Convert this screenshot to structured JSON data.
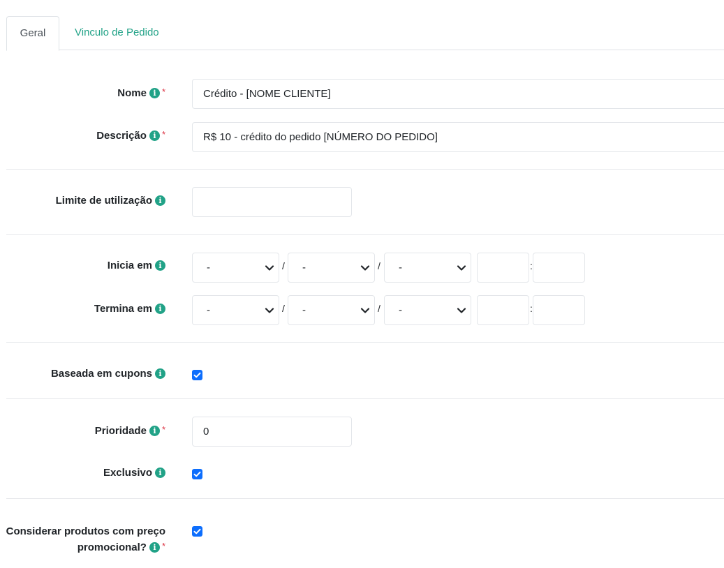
{
  "tabs": [
    {
      "label": "Geral",
      "active": true
    },
    {
      "label": "Vinculo de Pedido",
      "active": false
    }
  ],
  "fields": {
    "nome": {
      "label": "Nome",
      "value": "Crédito - [NOME CLIENTE]",
      "required": "*"
    },
    "descricao": {
      "label": "Descrição",
      "value": "R$ 10 - crédito do pedido [NÚMERO DO PEDIDO]",
      "required": "*"
    },
    "limite": {
      "label": "Limite de utilização",
      "value": ""
    },
    "inicia": {
      "label": "Inicia em",
      "day": "-",
      "month": "-",
      "year": "-",
      "separator": "/",
      "time_separator": ":"
    },
    "termina": {
      "label": "Termina em",
      "day": "-",
      "month": "-",
      "year": "-",
      "separator": "/",
      "time_separator": ":"
    },
    "cupons": {
      "label": "Baseada em cupons",
      "checked": true
    },
    "prioridade": {
      "label": "Prioridade",
      "value": "0",
      "required": "*"
    },
    "exclusivo": {
      "label": "Exclusivo",
      "checked": true
    },
    "promocional": {
      "label_line1": "Considerar produtos com preço",
      "label_line2": "promocional?",
      "checked": true,
      "required": "*"
    }
  },
  "icons": {
    "info": "i"
  },
  "colors": {
    "accent": "#21a287",
    "required": "#dc3545",
    "checkbox": "#0d6efd"
  }
}
